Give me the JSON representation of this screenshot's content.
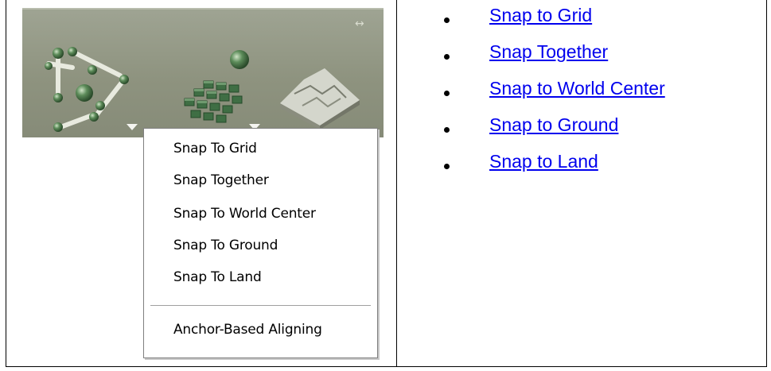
{
  "context_menu": {
    "items": [
      {
        "label": "Snap To Grid"
      },
      {
        "label": "Snap Together"
      },
      {
        "label": "Snap To World Center"
      },
      {
        "label": "Snap To Ground"
      },
      {
        "label": "Snap To Land"
      }
    ],
    "footer_item": {
      "label": "Anchor-Based Aligning"
    }
  },
  "links": [
    {
      "label": "Snap to Grid"
    },
    {
      "label": "Snap Together"
    },
    {
      "label": "Snap to World Center"
    },
    {
      "label": "Snap to Ground"
    },
    {
      "label": "Snap to Land"
    }
  ],
  "colors": {
    "link": "#0000ee",
    "toolbar_bg": "#8e937f"
  },
  "icons": [
    "resize-arrows-icon",
    "molecule-snap-icon",
    "sphere-icon",
    "grid-blocks-icon",
    "terrain-block-icon",
    "dropdown-caret-icon"
  ]
}
